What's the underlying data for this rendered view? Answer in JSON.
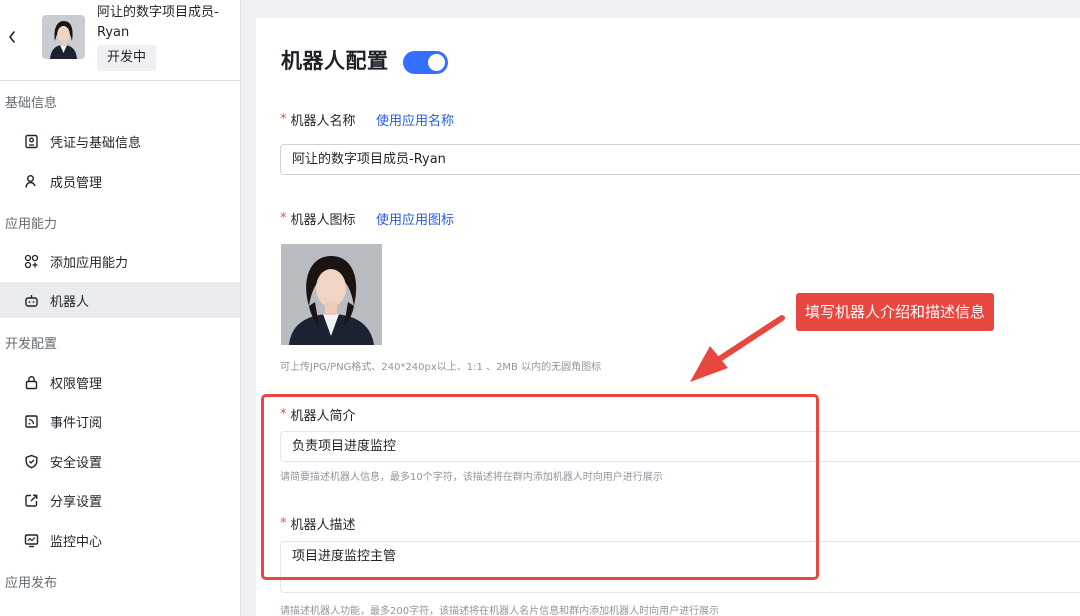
{
  "app": {
    "title": "阿让的数字项目成员-Ryan",
    "status": "开发中"
  },
  "sidebar": {
    "groups": [
      {
        "title": "基础信息"
      },
      {
        "title": "应用能力"
      },
      {
        "title": "开发配置"
      },
      {
        "title": "应用发布"
      }
    ],
    "items": [
      {
        "label": "凭证与基础信息",
        "icon": "credential-icon"
      },
      {
        "label": "成员管理",
        "icon": "member-icon"
      },
      {
        "label": "添加应用能力",
        "icon": "add-capability-icon"
      },
      {
        "label": "机器人",
        "icon": "robot-icon",
        "active": true
      },
      {
        "label": "权限管理",
        "icon": "lock-icon"
      },
      {
        "label": "事件订阅",
        "icon": "event-icon"
      },
      {
        "label": "安全设置",
        "icon": "shield-icon"
      },
      {
        "label": "分享设置",
        "icon": "share-icon"
      },
      {
        "label": "监控中心",
        "icon": "monitor-icon"
      }
    ]
  },
  "main": {
    "title": "机器人配置",
    "enabled": true,
    "name_field": {
      "label": "机器人名称",
      "link": "使用应用名称",
      "value": "阿让的数字项目成员-Ryan"
    },
    "icon_field": {
      "label": "机器人图标",
      "link": "使用应用图标",
      "hint": "可上传JPG/PNG格式、240*240px以上、1:1 、2MB 以内的无圆角图标"
    },
    "intro_field": {
      "label": "机器人简介",
      "value": "负责项目进度监控",
      "hint": "请简要描述机器人信息，最多10个字符，该描述将在群内添加机器人时向用户进行展示"
    },
    "desc_field": {
      "label": "机器人描述",
      "value": "项目进度监控主管",
      "hint": "请描述机器人功能，最多200字符，该描述将在机器人名片信息和群内添加机器人时向用户进行展示"
    }
  },
  "annotation": {
    "callout": "填写机器人介绍和描述信息",
    "color": "#e8473f"
  },
  "colors": {
    "accent": "#3370ff",
    "link": "#245bdb",
    "required": "#f54a45"
  }
}
